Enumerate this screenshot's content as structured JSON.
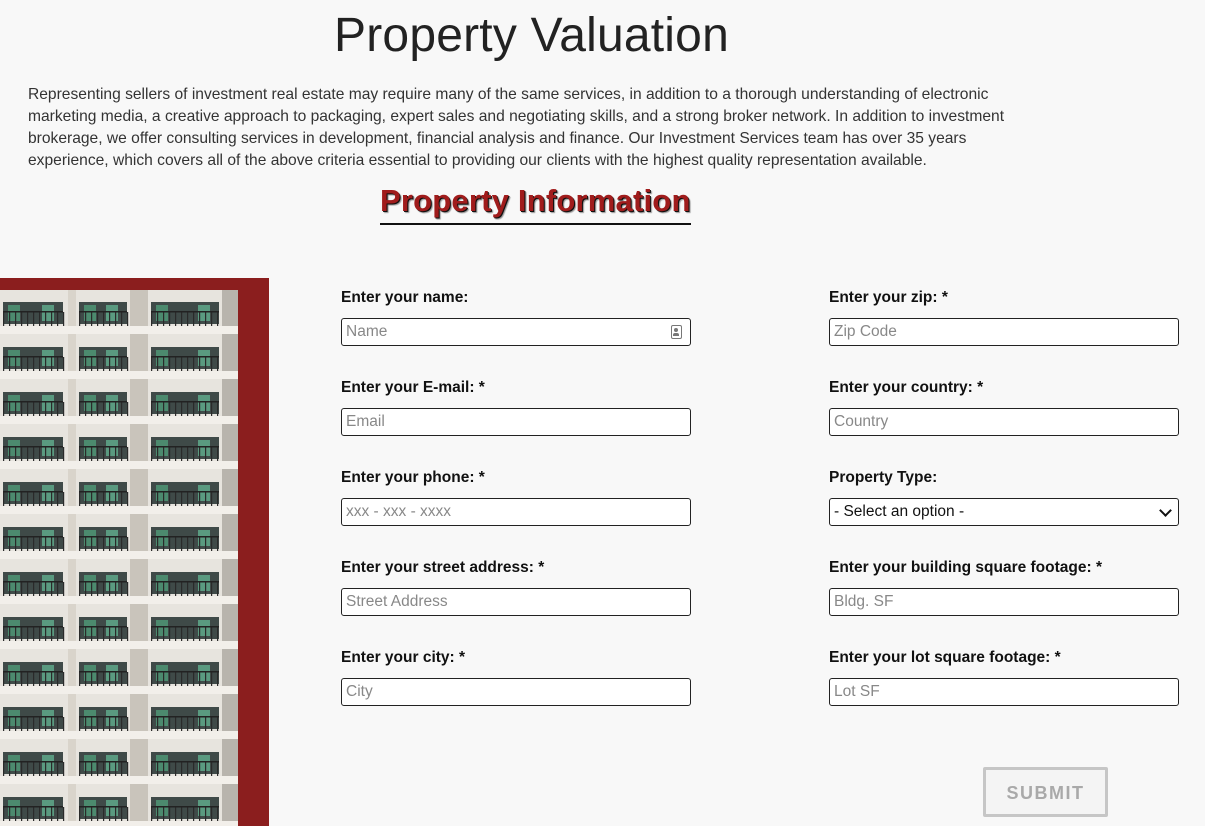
{
  "page": {
    "title": "Property Valuation",
    "intro": "Representing sellers of investment real estate may require many of the same services, in addition to a thorough understanding of electronic marketing media, a creative approach to packaging, expert sales and negotiating skills, and a strong broker network. In addition to investment brokerage, we offer consulting services in development, financial analysis and finance. Our Investment Services team has over 35 years experience, which covers all of the above criteria essential to providing our clients with the highest quality representation available.",
    "section_heading": "Property Information"
  },
  "colors": {
    "accent": "#a01c1c",
    "frame": "#8b1e1e",
    "background": "#f8f8f8"
  },
  "form": {
    "name": {
      "label": "Enter your name:",
      "placeholder": "Name",
      "value": ""
    },
    "email": {
      "label": "Enter your E-mail: *",
      "placeholder": "Email",
      "value": ""
    },
    "phone": {
      "label": "Enter your phone: *",
      "placeholder": "xxx - xxx - xxxx",
      "value": ""
    },
    "street": {
      "label": "Enter your street address: *",
      "placeholder": "Street Address",
      "value": ""
    },
    "city": {
      "label": "Enter your city: *",
      "placeholder": "City",
      "value": ""
    },
    "zip": {
      "label": "Enter your zip: *",
      "placeholder": "Zip Code",
      "value": ""
    },
    "country": {
      "label": "Enter your country: *",
      "placeholder": "Country",
      "value": ""
    },
    "property_type": {
      "label": "Property Type:",
      "selected": "- Select an option -"
    },
    "bldg_sf": {
      "label": "Enter your building square footage: *",
      "placeholder": "Bldg. SF",
      "value": ""
    },
    "lot_sf": {
      "label": "Enter your lot square footage: *",
      "placeholder": "Lot SF",
      "value": ""
    },
    "submit_label": "SUBMIT"
  },
  "icons": {
    "name_field_icon": "contact-card-icon",
    "select_icon": "chevron-down-icon"
  }
}
